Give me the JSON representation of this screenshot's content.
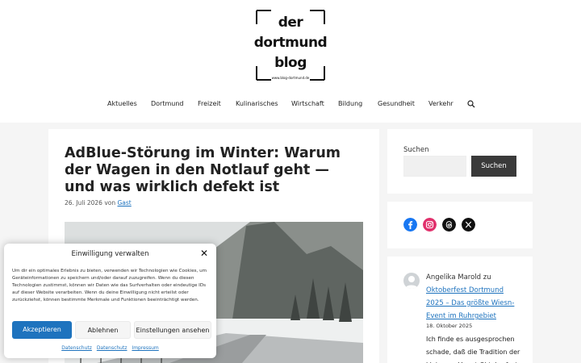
{
  "logo": {
    "line1": "der",
    "line2": "dortmund",
    "line3": "blog",
    "url_text": "www.blog-dortmund.de"
  },
  "nav": {
    "items": [
      "Aktuelles",
      "Dortmund",
      "Freizeit",
      "Kulinarisches",
      "Wirtschaft",
      "Bildung",
      "Gesundheit",
      "Verkehr"
    ],
    "search_icon": "search-icon"
  },
  "article": {
    "title": "AdBlue-Störung im Winter: Warum der Wagen in den Notlauf geht — und was wirklich defekt ist",
    "date": "26. Juli 2026",
    "by": "von",
    "author": "Gast"
  },
  "sidebar": {
    "search_label": "Suchen",
    "search_button": "Suchen",
    "social": [
      {
        "icon": "facebook-icon",
        "color": "#1877f2"
      },
      {
        "icon": "instagram-icon",
        "color": "#e1306c"
      },
      {
        "icon": "threads-icon",
        "color": "#111111"
      },
      {
        "icon": "x-icon",
        "color": "#111111"
      }
    ],
    "comment": {
      "author": "Angelika Marold",
      "connector": "zu",
      "link": "Oktoberfest Dortmund 2025 – Das größte Wiesn-Event im Ruhrgebiet",
      "date": "18. Oktober 2025",
      "text": "Ich finde es ausgesprochen schade, daß die Tradition der kleineren Vorort Oktoberfeste"
    }
  },
  "consent": {
    "title": "Einwilligung verwalten",
    "body": "Um dir ein optimales Erlebnis zu bieten, verwenden wir Technologien wie Cookies, um Geräteinformationen zu speichern und/oder darauf zuzugreifen. Wenn du diesen Technologien zustimmst, können wir Daten wie das Surfverhalten oder eindeutige IDs auf dieser Website verarbeiten. Wenn du deine Einwilligung nicht erteilst oder zurückziehst, können bestimmte Merkmale und Funktionen beeinträchtigt werden.",
    "accept": "Akzeptieren",
    "deny": "Ablehnen",
    "settings": "Einstellungen ansehen",
    "links": [
      "Datenschutz",
      "Datenschutz",
      "Impressum"
    ]
  },
  "colors": {
    "accent": "#1e73be",
    "button_dark": "#3a3a3a"
  }
}
